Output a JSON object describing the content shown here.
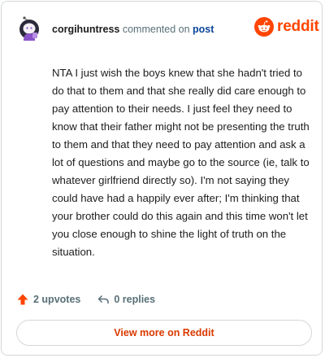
{
  "header": {
    "username": "corgihuntress",
    "action_text": "commented on",
    "target_link": "post"
  },
  "logo": {
    "icon": "reddit-snoo-icon",
    "wordmark": "reddit",
    "color": "#ff4500"
  },
  "comment": {
    "text": "NTA I just wish the boys knew that she hadn't tried to do that to them and that she really did care enough to pay attention to their needs. I just feel they need to know that their father might not be presenting the truth to them and that they need to pay attention and ask a lot of questions and maybe go to the source (ie, talk to whatever girlfriend directly so). I'm not saying they could have had a happily ever after; I'm thinking that your brother could do this again and this time won't let you close enough to shine the light of truth on the situation."
  },
  "footer": {
    "upvotes_label": "2 upvotes",
    "replies_label": "0 replies",
    "view_more_label": "View more on Reddit"
  },
  "colors": {
    "accent": "#ff4500",
    "link": "#0a449b",
    "muted": "#576f76",
    "button_text": "#d93a00"
  }
}
